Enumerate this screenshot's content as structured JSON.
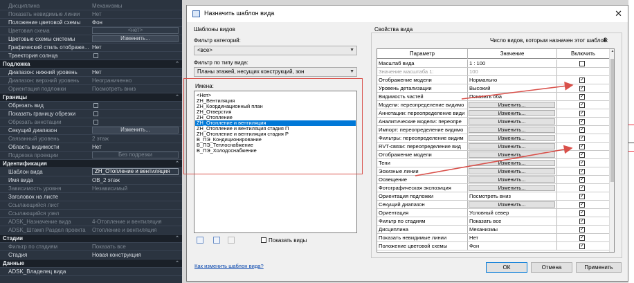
{
  "palette": {
    "rows": [
      {
        "k": "row",
        "label": "Дисциплина",
        "value": "Механизмы",
        "dim": true
      },
      {
        "k": "row",
        "label": "Показать невидимые линии",
        "value": "Нет",
        "dim": true
      },
      {
        "k": "row",
        "label": "Положение цветовой схемы",
        "value": "Фон"
      },
      {
        "k": "btnrow",
        "label": "Цветовая схема",
        "value": "<нет>",
        "dim": true
      },
      {
        "k": "btnrow",
        "label": "Цветовые схемы системы",
        "value": "Изменить..."
      },
      {
        "k": "row",
        "label": "Графический стиль отображе...",
        "value": "Нет"
      },
      {
        "k": "chk",
        "label": "Траектория солнца",
        "checked": false
      },
      {
        "k": "sec",
        "label": "Подложка"
      },
      {
        "k": "row",
        "label": "Диапазон: нижний уровень",
        "value": "Нет"
      },
      {
        "k": "row",
        "label": "Диапазон: верхний уровень",
        "value": "Неограниченно",
        "dim": true
      },
      {
        "k": "row",
        "label": "Ориентация подложки",
        "value": "Посмотреть вниз",
        "dim": true
      },
      {
        "k": "sec",
        "label": "Границы"
      },
      {
        "k": "chk",
        "label": "Обрезать вид",
        "checked": false
      },
      {
        "k": "chk",
        "label": "Показать границу обрезки",
        "checked": false
      },
      {
        "k": "chk",
        "label": "Обрезать аннотации",
        "checked": false,
        "dim": true
      },
      {
        "k": "btnrow",
        "label": "Секущий диапазон",
        "value": "Изменить..."
      },
      {
        "k": "row",
        "label": "Связанный уровень",
        "value": "2 этаж",
        "dim": true
      },
      {
        "k": "row",
        "label": "Область видимости",
        "value": "Нет"
      },
      {
        "k": "btnrow",
        "label": "Подрезка проекции",
        "value": "Без подрезки",
        "dim": true
      },
      {
        "k": "sec",
        "label": "Идентификация"
      },
      {
        "k": "field",
        "label": "Шаблон вида",
        "value": "ZH_Отопление и вентиляция"
      },
      {
        "k": "row",
        "label": "Имя вида",
        "value": "OB_2 этаж"
      },
      {
        "k": "row",
        "label": "Зависимость уровня",
        "value": "Независимый",
        "dim": true
      },
      {
        "k": "row",
        "label": "Заголовок на листе",
        "value": ""
      },
      {
        "k": "row",
        "label": "Ссылающийся лист",
        "value": "",
        "dim": true
      },
      {
        "k": "row",
        "label": "Ссылающийся узел",
        "value": "",
        "dim": true
      },
      {
        "k": "row",
        "label": "ADSK_Назначение вида",
        "value": "4-Отопление и вентиляция",
        "dim": true
      },
      {
        "k": "row",
        "label": "ADSK_Штамп Раздел проекта",
        "value": "Отопление и вентиляция",
        "dim": true
      },
      {
        "k": "sec",
        "label": "Стадии"
      },
      {
        "k": "row",
        "label": "Фильтр по стадиям",
        "value": "Показать все",
        "dim": true
      },
      {
        "k": "row",
        "label": "Стадия",
        "value": "Новая конструкция"
      },
      {
        "k": "sec",
        "label": "Данные"
      },
      {
        "k": "row",
        "label": "ADSK_Владелец вида",
        "value": ""
      }
    ]
  },
  "dialog": {
    "title": "Назначить шаблон вида",
    "close_glyph": "✕",
    "templates_group": "Шаблоны видов",
    "category_filter_label": "Фильтр категорий:",
    "category_filter_value": "<все>",
    "type_filter_label": "Фильтр по типу вида:",
    "type_filter_value": "Планы этажей, несущих конструкций, зон",
    "names_label": "Имена:",
    "names": [
      "<Нет>",
      "ZH_Вентиляция",
      "ZH_Координационный план",
      "ZH_Отверстия",
      "ZH_Отопление",
      "ZH_Отопление и вентиляция",
      "ZH_Отопление и вентиляция стадия П",
      "ZH_Отопление и вентиляция стадия Р",
      "В_ПЭ_Кондиционирование",
      "В_ПЭ_Теплоснабжение",
      "В_ПЭ_Холодоснабжение"
    ],
    "selected_name_index": 5,
    "show_views_label": "Показать виды",
    "help_link": "Как изменить шаблон вида?",
    "props_group": "Свойства вида",
    "views_count_label": "Число видов, которым назначен этот шаблон:",
    "views_count": "8",
    "columns": {
      "param": "Параметр",
      "value": "Значение",
      "include": "Включить"
    },
    "props": [
      {
        "p": "Масштаб вида",
        "v": "1 : 100",
        "btn": false,
        "inc": "off"
      },
      {
        "p": "Значение масштаба    1:",
        "v": "100",
        "btn": false,
        "inc": "none",
        "dim": true
      },
      {
        "p": "Отображение модели",
        "v": "Нормально",
        "btn": false,
        "inc": "on"
      },
      {
        "p": "Уровень детализации",
        "v": "Высокий",
        "btn": false,
        "inc": "on"
      },
      {
        "p": "Видимость частей",
        "v": "Показать оба",
        "btn": false,
        "inc": "on"
      },
      {
        "p": "Модели: переопределение видимо",
        "v": "Изменить...",
        "btn": true,
        "inc": "on"
      },
      {
        "p": "Аннотации: переопределение види",
        "v": "Изменить...",
        "btn": true,
        "inc": "on"
      },
      {
        "p": "Аналитические модели: переопре",
        "v": "Изменить...",
        "btn": true,
        "inc": "on"
      },
      {
        "p": "Импорт: переопределение видимо",
        "v": "Изменить...",
        "btn": true,
        "inc": "on"
      },
      {
        "p": "Фильтры: переопределение видим",
        "v": "Изменить...",
        "btn": true,
        "inc": "on"
      },
      {
        "p": "RVT-связи: переопределение вид",
        "v": "Изменить...",
        "btn": true,
        "inc": "on"
      },
      {
        "p": "Отображение модели",
        "v": "Изменить...",
        "btn": true,
        "inc": "on"
      },
      {
        "p": "Тени",
        "v": "Изменить...",
        "btn": true,
        "inc": "on"
      },
      {
        "p": "Эскизные линии",
        "v": "Изменить...",
        "btn": true,
        "inc": "on"
      },
      {
        "p": "Освещение",
        "v": "Изменить...",
        "btn": true,
        "inc": "on"
      },
      {
        "p": "Фотографическая экспозиция",
        "v": "Изменить...",
        "btn": true,
        "inc": "on"
      },
      {
        "p": "Ориентация подложки",
        "v": "Посмотреть вниз",
        "btn": false,
        "inc": "on"
      },
      {
        "p": "Секущий диапазон",
        "v": "Изменить...",
        "btn": true,
        "inc": "on"
      },
      {
        "p": "Ориентация",
        "v": "Условный север",
        "btn": false,
        "inc": "on"
      },
      {
        "p": "Фильтр по стадиям",
        "v": "Показать все",
        "btn": false,
        "inc": "on"
      },
      {
        "p": "Дисциплина",
        "v": "Механизмы",
        "btn": false,
        "inc": "on"
      },
      {
        "p": "Показать невидимые линии",
        "v": "Нет",
        "btn": false,
        "inc": "on"
      },
      {
        "p": "Положение цветовой схемы",
        "v": "Фон",
        "btn": false,
        "inc": "on"
      }
    ],
    "buttons": {
      "ok": "ОК",
      "cancel": "Отмена",
      "apply": "Применить"
    }
  },
  "colors": {
    "accent": "#0078d7",
    "annotation": "#d9504a",
    "palette_bg": "#2b3440"
  }
}
